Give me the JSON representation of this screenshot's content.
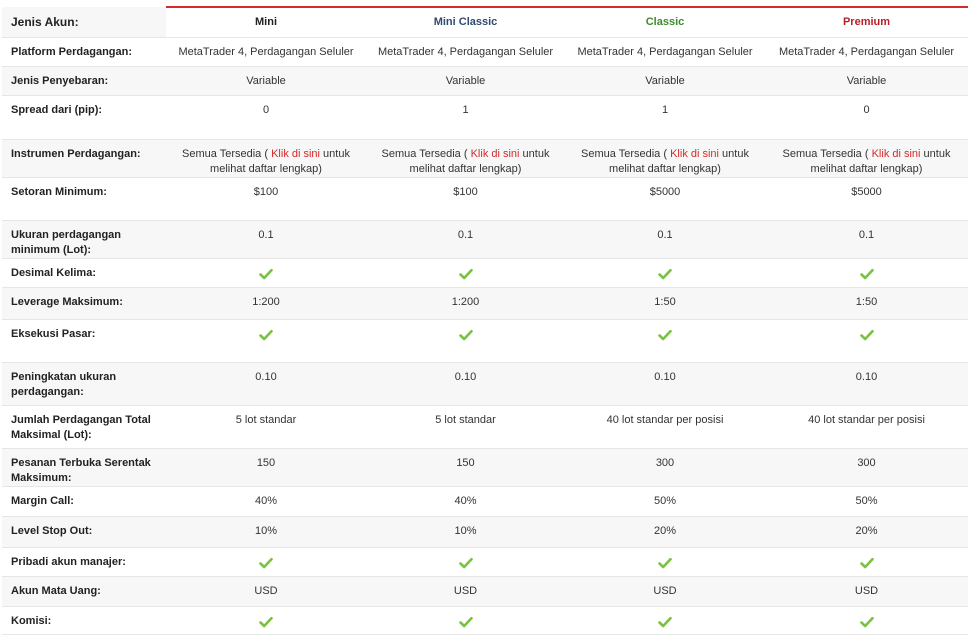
{
  "header": {
    "label": "Jenis Akun:",
    "columns": [
      {
        "name": "Mini",
        "color": "#222222"
      },
      {
        "name": "Mini Classic",
        "color": "#2f4a6e"
      },
      {
        "name": "Classic",
        "color": "#3d8b2a"
      },
      {
        "name": "Premium",
        "color": "#b51f2a"
      }
    ]
  },
  "colors": {
    "accent_red": "#d32a2a",
    "check_green": "#7cc242"
  },
  "rows": [
    {
      "label": "Platform Perdagangan:",
      "type": "text",
      "values": [
        "MetaTrader 4, Perdagangan Seluler",
        "MetaTrader 4, Perdagangan Seluler",
        "MetaTrader 4, Perdagangan Seluler",
        "MetaTrader 4, Perdagangan Seluler"
      ]
    },
    {
      "label": "Jenis Penyebaran:",
      "type": "text",
      "values": [
        "Variable",
        "Variable",
        "Variable",
        "Variable"
      ]
    },
    {
      "label": "Spread dari (pip):",
      "type": "text",
      "values": [
        "0",
        "1",
        "1",
        "0"
      ]
    },
    {
      "label": "Instrumen Perdagangan:",
      "type": "instrument",
      "pre": "Semua Tersedia ( ",
      "link": "Klik di sini",
      "post": " untuk melihat daftar lengkap)"
    },
    {
      "label": "Setoran Minimum:",
      "type": "text",
      "values": [
        "$100",
        "$100",
        "$5000",
        "$5000"
      ]
    },
    {
      "label": "Ukuran perdagangan minimum (Lot):",
      "type": "text",
      "values": [
        "0.1",
        "0.1",
        "0.1",
        "0.1"
      ]
    },
    {
      "label": "Desimal Kelima:",
      "type": "check",
      "icon": "checkmark-icon"
    },
    {
      "label": "Leverage Maksimum:",
      "type": "text",
      "values": [
        "1:200",
        "1:200",
        "1:50",
        "1:50"
      ]
    },
    {
      "label": "Eksekusi Pasar:",
      "type": "check",
      "icon": "checkmark-icon"
    },
    {
      "label": "Peningkatan ukuran perdagangan:",
      "type": "text",
      "values": [
        "0.10",
        "0.10",
        "0.10",
        "0.10"
      ]
    },
    {
      "label": "Jumlah Perdagangan Total Maksimal (Lot):",
      "type": "text",
      "values": [
        "5 lot standar",
        "5 lot standar",
        "40 lot standar per posisi",
        "40 lot standar per posisi"
      ]
    },
    {
      "label": "Pesanan Terbuka Serentak Maksimum:",
      "type": "text",
      "values": [
        "150",
        "150",
        "300",
        "300"
      ]
    },
    {
      "label": "Margin Call:",
      "type": "text",
      "values": [
        "40%",
        "40%",
        "50%",
        "50%"
      ]
    },
    {
      "label": "Level Stop Out:",
      "type": "text",
      "values": [
        "10%",
        "10%",
        "20%",
        "20%"
      ]
    },
    {
      "label": "Pribadi akun manajer:",
      "type": "check",
      "icon": "checkmark-icon"
    },
    {
      "label": "Akun Mata Uang:",
      "type": "text",
      "values": [
        "USD",
        "USD",
        "USD",
        "USD"
      ]
    },
    {
      "label": "Komisi:",
      "type": "check",
      "icon": "checkmark-icon"
    }
  ]
}
